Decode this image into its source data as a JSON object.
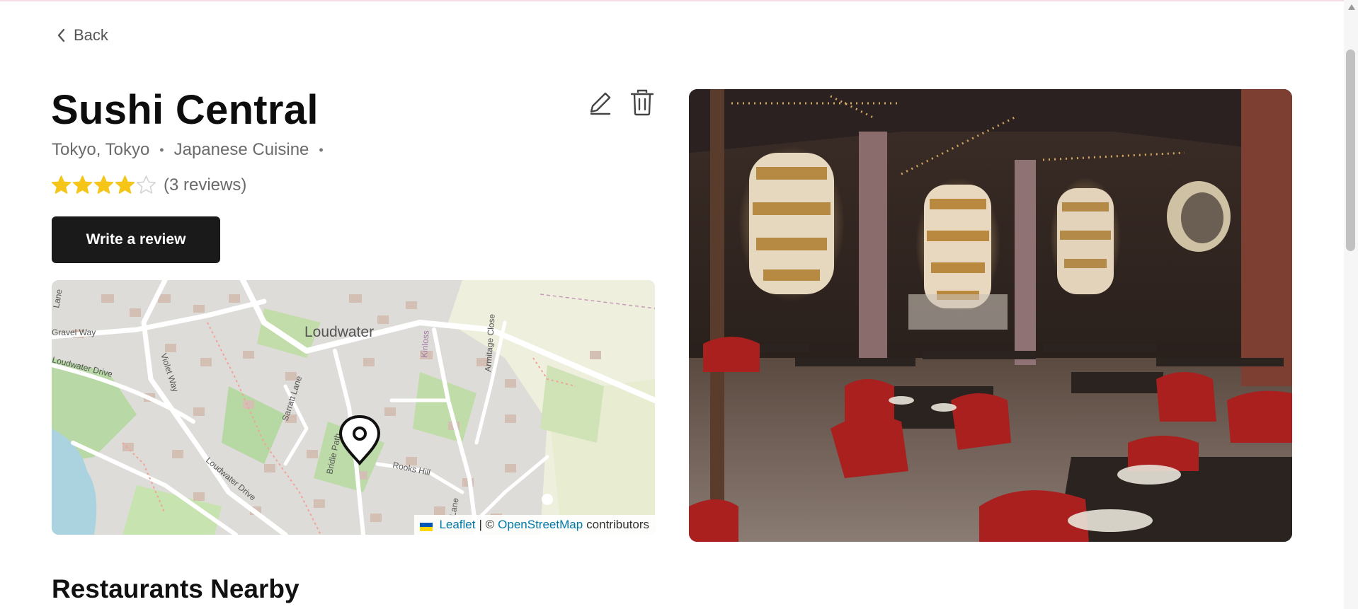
{
  "nav": {
    "back_label": "Back"
  },
  "restaurant": {
    "name": "Sushi Central",
    "location": "Tokyo, Tokyo",
    "cuisine": "Japanese Cuisine",
    "separator": "•",
    "rating": 4,
    "rating_max": 5,
    "reviews_text": "(3 reviews)"
  },
  "actions": {
    "write_review_label": "Write a review",
    "edit_icon": "pencil-icon",
    "delete_icon": "trash-icon"
  },
  "map": {
    "place_labels": [
      "Loudwater",
      "Violet Way",
      "Sarratt Lane",
      "Bridle Path",
      "Rooks Hill",
      "Armitage Close",
      "Kinloss",
      "Loudwater Drive",
      "Loudwater Drive",
      "Gravel Way",
      "Lane",
      "Lane"
    ],
    "attribution": {
      "leaflet": "Leaflet",
      "sep": "| ©",
      "osm": "OpenStreetMap",
      "suffix": "contributors"
    }
  },
  "photo": {
    "alt": "Restaurant interior"
  },
  "sections": {
    "nearby_title": "Restaurants Nearby"
  },
  "colors": {
    "star": "#f5c518",
    "star_empty": "#d4d4d4",
    "button": "#1a1a1a",
    "link": "#0078a8"
  }
}
